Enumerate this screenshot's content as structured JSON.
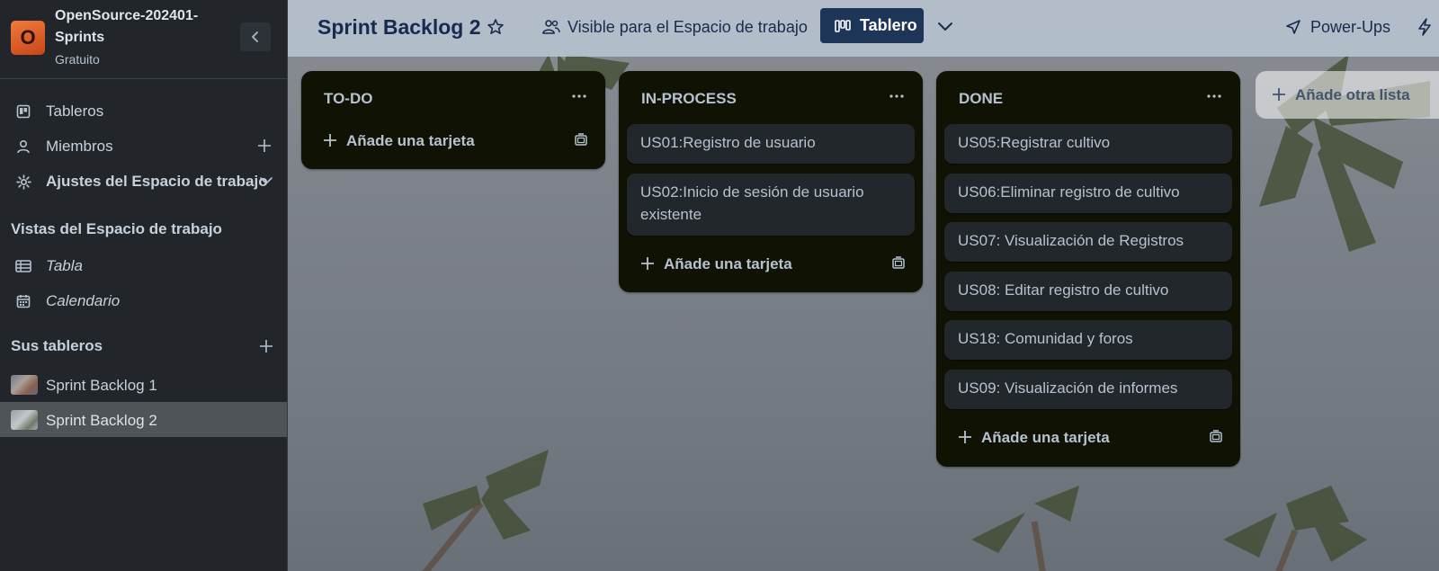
{
  "workspace": {
    "logo_letter": "O",
    "name": "OpenSource-202401-Sprints",
    "plan": "Gratuito"
  },
  "sidebar": {
    "nav": [
      {
        "label": "Tableros",
        "icon": "board-icon"
      },
      {
        "label": "Miembros",
        "icon": "person-icon",
        "action_icon": "plus-icon"
      },
      {
        "label": "Ajustes del Espacio de trabajo",
        "icon": "gear-icon",
        "action_icon": "chevron-down-icon"
      }
    ],
    "views_title": "Vistas del Espacio de trabajo",
    "views": [
      {
        "label": "Tabla",
        "icon": "table-icon"
      },
      {
        "label": "Calendario",
        "icon": "calendar-icon"
      }
    ],
    "boards_title": "Sus tableros",
    "boards": [
      {
        "label": "Sprint Backlog 1",
        "active": false
      },
      {
        "label": "Sprint Backlog 2",
        "active": true
      }
    ]
  },
  "header": {
    "board_title": "Sprint Backlog 2",
    "visibility": "Visible para el Espacio de trabajo",
    "view_label": "Tablero",
    "powerups": "Power-Ups"
  },
  "lists": [
    {
      "title": "TO-DO",
      "cards": [],
      "add_card": "Añade una tarjeta"
    },
    {
      "title": "IN-PROCESS",
      "cards": [
        "US01:Registro de usuario",
        "US02:Inicio de sesión de usuario existente"
      ],
      "add_card": "Añade una tarjeta"
    },
    {
      "title": "DONE",
      "cards": [
        "US05:Registrar cultivo",
        "US06:Eliminar registro de cultivo",
        "US07: Visualización de Registros",
        "US08: Editar registro de cultivo",
        "US18: Comunidad y foros",
        "US09: Visualización de informes"
      ],
      "add_card": "Añade una tarjeta"
    }
  ],
  "add_list": "Añade otra lista",
  "colors": {
    "list_bg": "#101204",
    "card_bg": "#22272b",
    "text": "#b6c2cf",
    "header_accent": "#1d3557",
    "sidebar_bg": "#22262b",
    "logo": "#e0632a"
  }
}
